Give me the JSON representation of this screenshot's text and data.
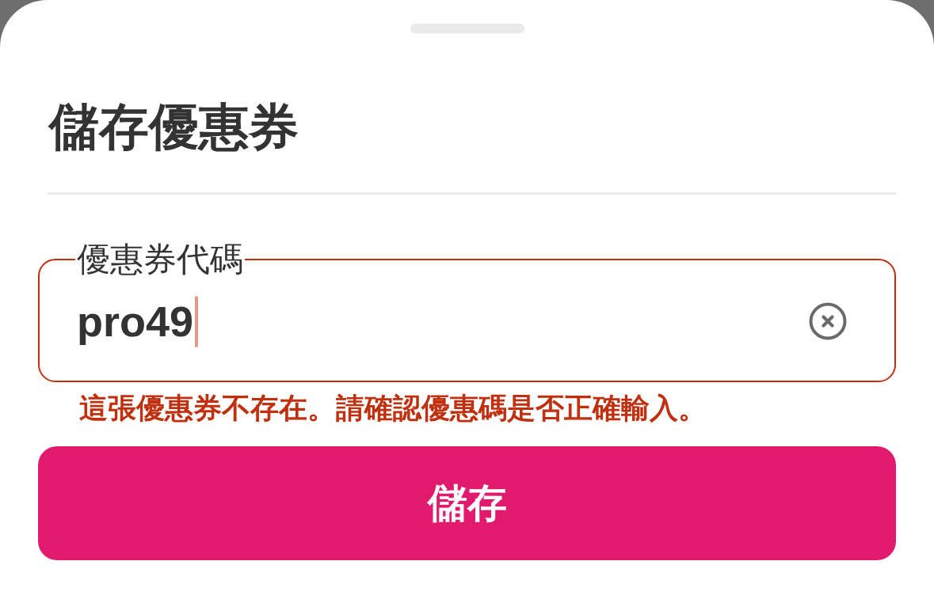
{
  "sheet": {
    "title": "儲存優惠券"
  },
  "code_field": {
    "label": "優惠券代碼",
    "value": "pro49",
    "focused": true,
    "invalid": true,
    "error": "這張優惠券不存在。請確認優惠碼是否正確輸入。"
  },
  "save_button": {
    "label": "儲存"
  }
}
